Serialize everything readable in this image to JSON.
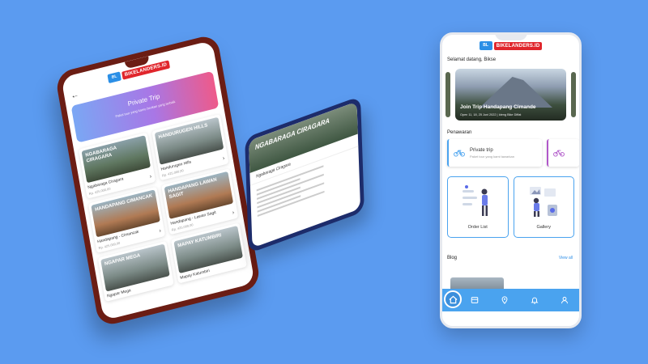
{
  "brand": {
    "logo_text": "BIKELANDERS.ID",
    "logo_mark": "BL"
  },
  "colors": {
    "background": "#5b9bf0",
    "accent": "#4aa3ef",
    "brand_red": "#e0262c"
  },
  "phone_left": {
    "back_icon": "arrow-left-icon",
    "banner": {
      "title": "Private Trip",
      "subtitle": "Paket tour yang kamu berikan yang terbaik"
    },
    "cards": [
      {
        "image_text": "NGABARAGA CIRAGARA",
        "name": "Ngabaraga Ciragara",
        "price": "Rp. 425.000,00"
      },
      {
        "image_text": "HANDURUGEN HILLS",
        "name": "Handurugen Hills",
        "price": "Rp. 425.000,00"
      },
      {
        "image_text": "HANDAPANG CIMANCAK",
        "name": "Handapang - Cimancak",
        "price": "Rp. 425.000,00"
      },
      {
        "image_text": "HANDAPANG LAWAN SAGIT",
        "name": "Handapang - Lawan Sagit",
        "price": "Rp. 425.000,00"
      },
      {
        "image_text": "NGAPAR MEGA",
        "name": "Ngapar Mega",
        "price": ""
      },
      {
        "image_text": "MAPAY KATUMBIRI",
        "name": "Mapay Katumbiri",
        "price": ""
      }
    ]
  },
  "phone_middle": {
    "hero_text": "NGABARAGA CIRAGARA",
    "title": "Ngabaraga Ciragara"
  },
  "phone_right": {
    "greeting": "Selamat datang, Bikse",
    "slider": {
      "caption": "Join Trip Handapang Cimande",
      "subcaption": "Open 11, 18, 25 Juni 2022 | Ideng Bike Diffat"
    },
    "offers_title": "Penawaran",
    "offer": {
      "title": "Private trip",
      "subtitle": "Paket tour yang kami tawarkan",
      "icon": "bicycle-icon"
    },
    "offer_peek_icon": "bicycle-icon",
    "tiles": [
      {
        "label": "Order List",
        "icon": "order-list-illustration"
      },
      {
        "label": "Gallery",
        "icon": "gallery-illustration"
      }
    ],
    "blog": {
      "title": "Blog",
      "view_all": "View all"
    },
    "nav": [
      "home-icon",
      "receipt-icon",
      "location-icon",
      "bell-icon",
      "user-icon"
    ]
  }
}
